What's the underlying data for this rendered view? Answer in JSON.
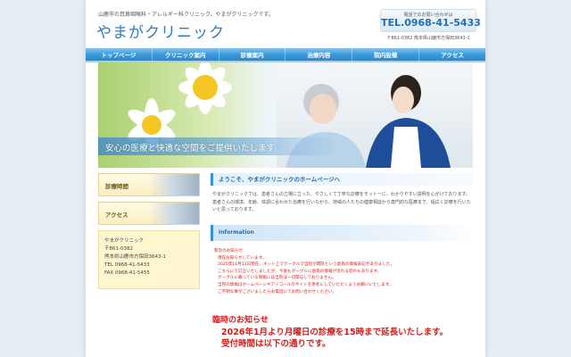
{
  "header": {
    "tagline": "山鹿市の耳鼻咽喉科・アレルギー科クリニック、やまがクリニックです。",
    "logo": "やまがクリニック",
    "contact_label": "電話でのお問い合わせは",
    "tel": "TEL.0968-41-5433",
    "address": "〒861-0382 熊本県山鹿市方保田3643-1"
  },
  "nav": {
    "items": [
      "トップページ",
      "クリニック案内",
      "診療案内",
      "治療内容",
      "院内設備",
      "アクセス"
    ]
  },
  "hero": {
    "caption": "安心の医療と快適な空間をご提供いたします"
  },
  "sidebar": {
    "buttons": [
      "診療時間",
      "アクセス"
    ],
    "info": {
      "name": "やまがクリニック",
      "zip": "〒861-0382",
      "address": "熊本県山鹿市方保田3643-1",
      "tel": "TEL 0968-41-5433",
      "fax": "FAX 0968-41-5455"
    }
  },
  "main": {
    "welcome_heading": "ようこそ、やまがクリニックのホームページへ",
    "intro": "やまがクリニックでは、患者さんの立場に立った、やさしくて丁寧な診療をモットーに、わかりやすい説明を心がけております。患者さんの環境、年齢、体調に合わせた治療を行いながら、地域の人たちの健康相談から専門的な医療まで、幅広く診療を行いたいと思っております。",
    "info_heading": "Information",
    "notice": {
      "title": "緊急のお知らせ",
      "lines": [
        "現在お知らせしています。",
        "2025年11月11日現在、ネット上でグーグルで当院が閉院という虚偽の情報表記がありました。",
        "こちらにて訂正いたしましたが、今後もグーグルに虚偽の情報が流れる恐れもあります。",
        "グーグルに載っている情報には当院は一切関与しておりません。",
        "当院の情報はホームページやアイコールのサイトを参考にしていただくようお願いいたします。",
        "ご不明な事がございましたらお電話にてお問い合わせください。"
      ]
    },
    "temporary": {
      "title": "臨時のお知らせ",
      "lines": [
        "2026年1月より月曜日の診療を15時まで延長いたします。",
        "受付時間は以下の通りです。"
      ]
    }
  },
  "colors": {
    "brand_blue": "#2f7bc0",
    "nav_blue": "#3b97d8",
    "notice_red": "#e0201c",
    "side_yellow": "#fff6cf"
  }
}
